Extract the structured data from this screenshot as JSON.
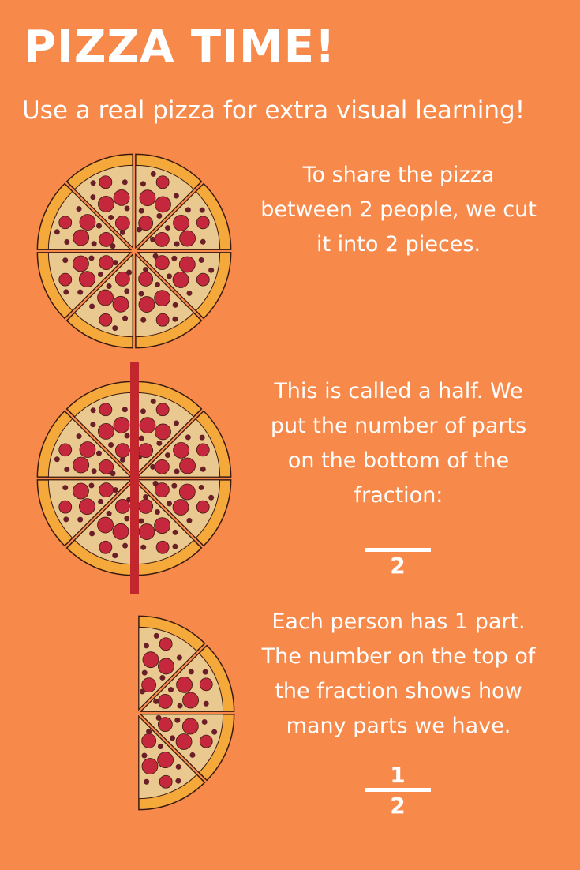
{
  "header": {
    "title": "PIZZA TIME!",
    "subtitle": "Use a real pizza for extra visual learning!"
  },
  "steps": [
    {
      "text_lines": [
        "To share the pizza",
        "between 2 people, we cut",
        "it into 2 pieces."
      ]
    },
    {
      "text_lines": [
        "This is called a half. We",
        "put the number of parts",
        "on the bottom of the",
        "fraction:"
      ],
      "fraction": {
        "numerator": "",
        "denominator": "2"
      }
    },
    {
      "text_lines": [
        "Each person has 1 part.",
        "The number on the top of",
        "the fraction shows how",
        "many parts we have."
      ],
      "fraction": {
        "numerator": "1",
        "denominator": "2"
      }
    }
  ],
  "colors": {
    "background": "#F7894A",
    "crust": "#F6A93B",
    "cheese": "#E9C98F",
    "pepperoni": "#C5283D",
    "olive": "#6A1E28",
    "cut_line": "#C1272D"
  },
  "illustrations": [
    {
      "name": "whole-pizza",
      "slices": 8
    },
    {
      "name": "pizza-cut-in-half",
      "slices": 8
    },
    {
      "name": "half-pizza",
      "slices": 4
    }
  ]
}
